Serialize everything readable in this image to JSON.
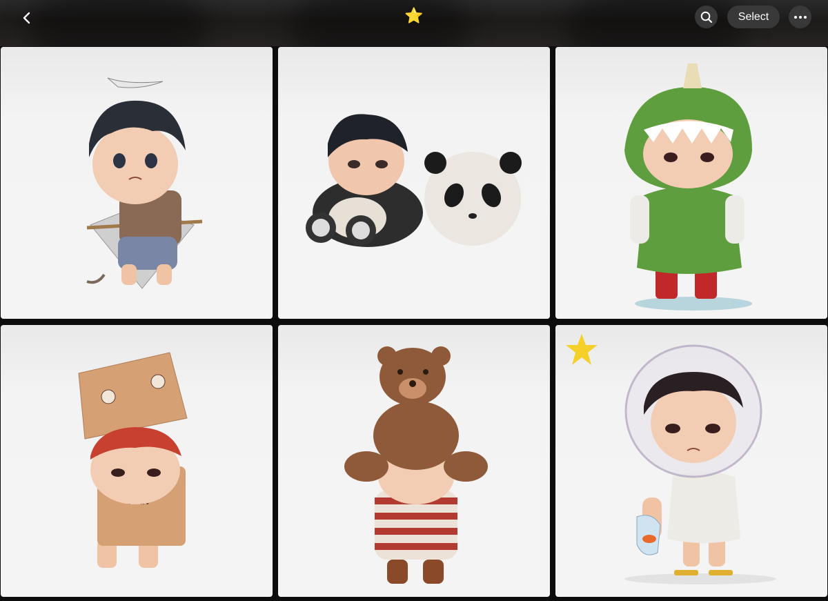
{
  "header": {
    "back_icon": "chevron-left-icon",
    "album_icon": "star-emoji",
    "album_glyph": "⭐",
    "search_icon": "magnifier-icon",
    "select_label": "Select",
    "more_icon": "ellipsis-icon"
  },
  "grid": {
    "photos": [
      {
        "subject": "figure-boy-kite",
        "favorite": false
      },
      {
        "subject": "figure-boy-panda",
        "favorite": false
      },
      {
        "subject": "figure-dino-raincoat",
        "favorite": false
      },
      {
        "subject": "figure-cardboard-dino",
        "favorite": false
      },
      {
        "subject": "figure-teddy-bear",
        "favorite": false
      },
      {
        "subject": "figure-bubble-helmet",
        "favorite": true
      }
    ]
  },
  "colors": {
    "header_bg": "#1f1d1c",
    "tile_bg": "#f4f4f4",
    "favorite_star": "#f5d02a",
    "button_bg": "#3c3c3c"
  }
}
